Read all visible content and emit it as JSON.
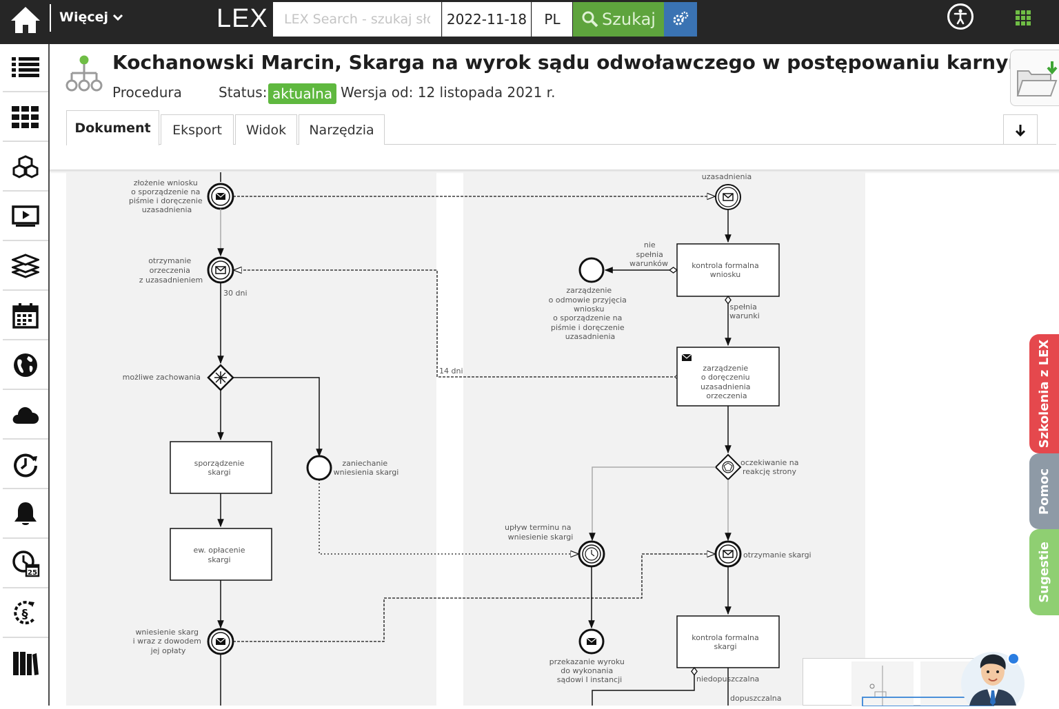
{
  "topbar": {
    "more_label": "Więcej",
    "logo": "LEX",
    "search_placeholder": "LEX Search - szukaj słów",
    "date": "2022-11-18",
    "language": "PL",
    "search_button": "Szukaj"
  },
  "sidebar": {
    "icons": [
      "list-icon",
      "grid-icon",
      "cubes-icon",
      "video-icon",
      "layers-icon",
      "calendar-icon",
      "globe-icon",
      "cloud-icon",
      "clock-arrow-icon",
      "bell-icon",
      "calendar-clock-icon",
      "paragraph-history-icon",
      "books-icon"
    ],
    "calendar_badge": "25"
  },
  "document": {
    "title": "Kochanowski Marcin, Skarga na wyrok sądu odwoławczego w postępowaniu karnym",
    "type": "Procedura",
    "status_label": "Status:",
    "status": "aktualna",
    "version": "Wersja od: 12 listopada 2021 r."
  },
  "tabs": [
    "Dokument",
    "Eksport",
    "Widok",
    "Narzędzia"
  ],
  "diagram": {
    "left": {
      "ev_wniosek": [
        "złożenie wniosku",
        "o sporządzenie na",
        "piśmie i doręczenie",
        "uzasadnienia"
      ],
      "ev_otrzymanie": [
        "otrzymanie",
        "orzeczenia",
        "z uzasadnieniem"
      ],
      "days30": "30 dni",
      "gateway": "możliwe zachowania",
      "task_sporzadzenie": [
        "sporządzenie",
        "skargi"
      ],
      "task_oplacenie": [
        "ew. opłacenie",
        "skargi"
      ],
      "end_zaniechanie": [
        "zaniechanie",
        "wniesienia skargi"
      ],
      "ev_wniesienie": [
        "wniesienie skarg",
        "i wraz z dowodem",
        "jej opłaty"
      ]
    },
    "right": {
      "ev_uzasadnienie": "uzasadnienia",
      "task_kontrola_wniosku": [
        "kontrola formalna",
        "wniosku"
      ],
      "flow_nie": [
        "nie",
        "spełnia",
        "warunków"
      ],
      "end_odmowa": [
        "zarządzenie",
        "o odmowie przyjęcia",
        "wniosku",
        "o sporządzenie na",
        "piśmie i doręczenie",
        "uzasadnienia"
      ],
      "flow_spelnia": [
        "spełnia",
        "warunki"
      ],
      "days14": "14 dni",
      "task_zarzadzenie": [
        "zarządzenie",
        "o doręczeniu",
        "uzasadnienia",
        "orzeczenia"
      ],
      "gateway_oczekiwanie": [
        "oczekiwanie na",
        "reakcję strony"
      ],
      "timer_uplyw": [
        "upływ terminu na",
        "wniesienie skargi"
      ],
      "ev_otrzymanie_skargi": "otrzymanie skargi",
      "end_przekazanie": [
        "przekazanie wyroku",
        "do wykonania",
        "sądowi I instancji"
      ],
      "task_kontrola_skargi": [
        "kontrola formalna",
        "skargi"
      ],
      "flow_niedopuszczalna": "niedopuszczalna",
      "flow_dopuszczalna": "dopuszczalna"
    }
  },
  "side_tabs": {
    "szkolenia": "Szkolenia z LEX",
    "pomoc": "Pomoc",
    "sugestie": "Sugestie"
  },
  "colors": {
    "topbar_bg": "#262626",
    "search_green": "#5ea43d",
    "settings_blue": "#3a73b3",
    "status_green": "#5fb83f",
    "szkolenia_red": "#e5484d",
    "pomoc_gray": "#8e9aa6",
    "sugestie_green": "#8fcf72",
    "lane_gray": "#f2f2f2"
  }
}
